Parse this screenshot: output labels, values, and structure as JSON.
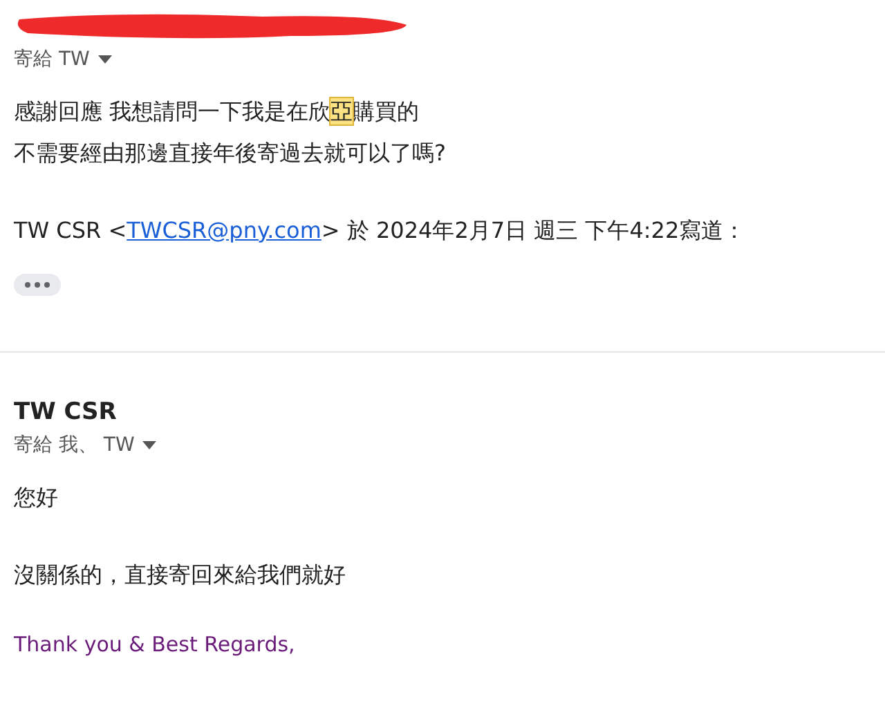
{
  "messages": [
    {
      "sender_redacted": true,
      "recipients": "寄給 TW",
      "body": [
        {
          "segments": [
            {
              "text": "感謝回應 我想請問一下我是在欣",
              "highlighted": false
            },
            {
              "text": "亞",
              "highlighted": true
            },
            {
              "text": "購買的",
              "highlighted": false
            }
          ]
        },
        {
          "segments": [
            {
              "text": "不需要經由那邊直接年後寄過去就可以了嗎?",
              "highlighted": false
            }
          ]
        }
      ],
      "quote": {
        "name": "TW CSR <",
        "email": "TWCSR@pny.com",
        "rest": "> 於 2024年2月7日 週三 下午4:22寫道："
      },
      "collapsed": true
    },
    {
      "sender_redacted": false,
      "sender": "TW CSR",
      "recipients": "寄給 我、 TW",
      "body": [
        {
          "segments": [
            {
              "text": "您好",
              "highlighted": false
            }
          ]
        },
        {
          "segments": [
            {
              "text": "沒關係的，直接寄回來給我們就好",
              "highlighted": false
            }
          ]
        }
      ],
      "signature": "Thank you & Best Regards,"
    }
  ]
}
